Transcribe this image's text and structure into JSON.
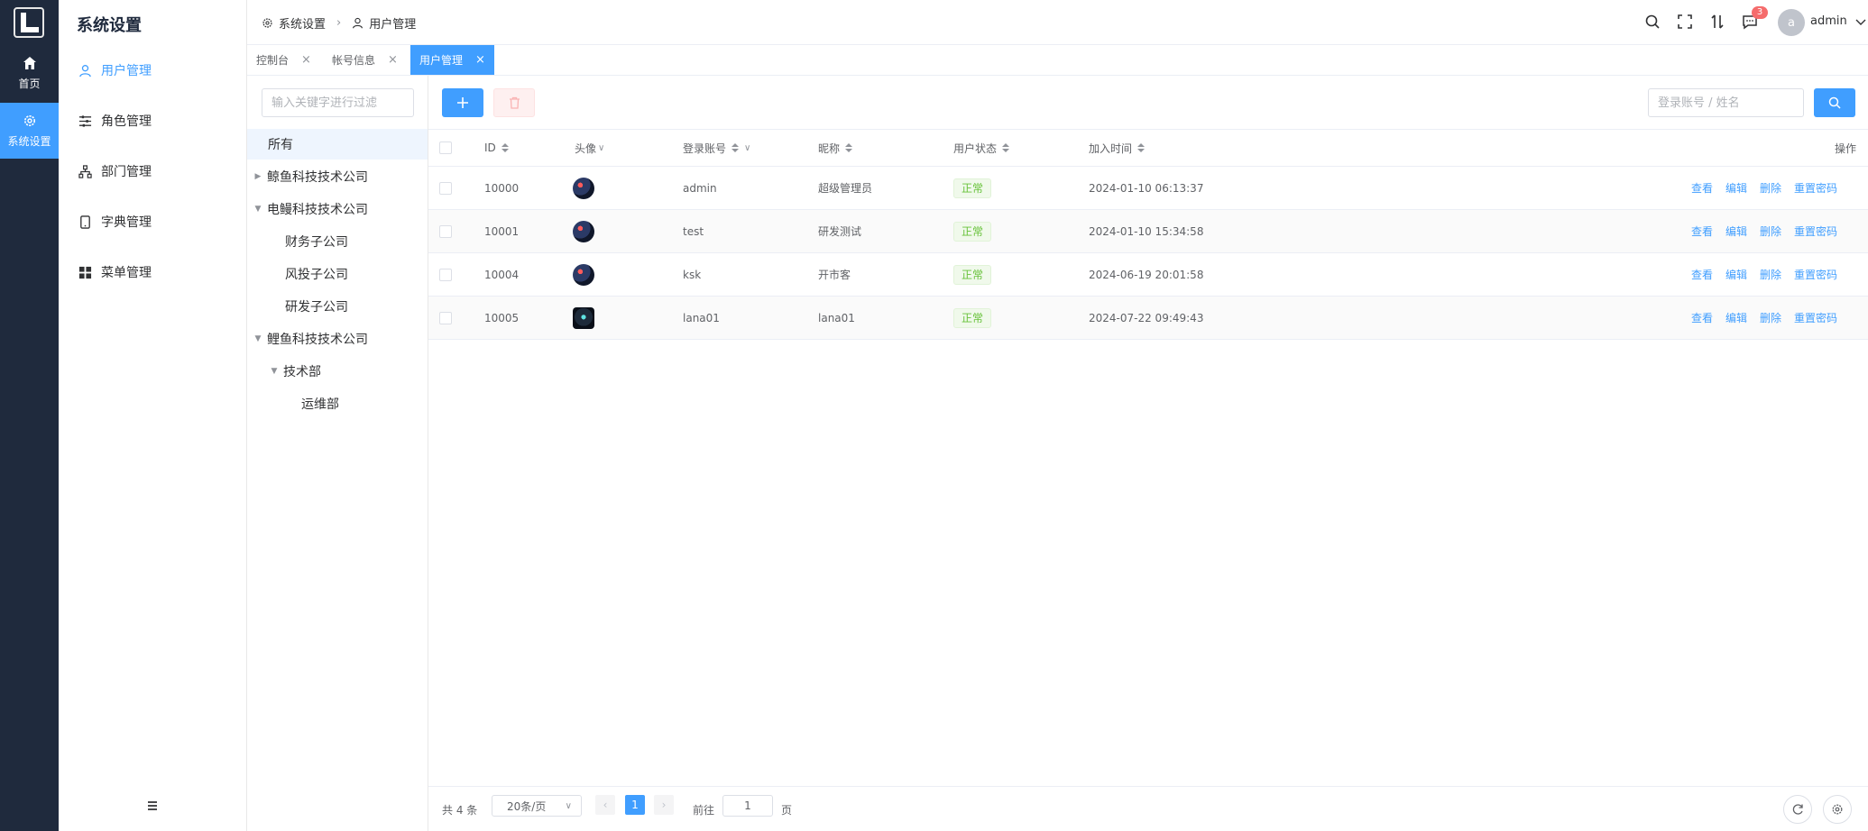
{
  "rail": {
    "home_label": "首页",
    "settings_label": "系统设置"
  },
  "submenu": {
    "title": "系统设置",
    "items": [
      {
        "label": "用户管理",
        "icon": "user-icon"
      },
      {
        "label": "角色管理",
        "icon": "sliders-icon"
      },
      {
        "label": "部门管理",
        "icon": "org-icon"
      },
      {
        "label": "字典管理",
        "icon": "tablet-icon"
      },
      {
        "label": "菜单管理",
        "icon": "grid-icon"
      }
    ]
  },
  "header": {
    "breadcrumb": [
      "系统设置",
      "用户管理"
    ],
    "notifications": "3",
    "avatar_letter": "a",
    "username": "admin"
  },
  "tabs": [
    {
      "label": "控制台"
    },
    {
      "label": "帐号信息"
    },
    {
      "label": "用户管理"
    }
  ],
  "tree": {
    "filter_placeholder": "输入关键字进行过滤",
    "nodes": [
      {
        "label": "所有"
      },
      {
        "label": "鲸鱼科技技术公司"
      },
      {
        "label": "电鳗科技技术公司"
      },
      {
        "label": "财务子公司"
      },
      {
        "label": "风投子公司"
      },
      {
        "label": "研发子公司"
      },
      {
        "label": "鲤鱼科技技术公司"
      },
      {
        "label": "技术部"
      },
      {
        "label": "运维部"
      }
    ]
  },
  "toolbar": {
    "search_placeholder": "登录账号 / 姓名"
  },
  "table": {
    "headers": {
      "id": "ID",
      "avatar": "头像",
      "account": "登录账号",
      "nickname": "昵称",
      "status": "用户状态",
      "joined": "加入时间",
      "actions": "操作"
    },
    "rows": [
      {
        "id": "10000",
        "account": "admin",
        "nickname": "超级管理员",
        "status": "正常",
        "joined": "2024-01-10 06:13:37"
      },
      {
        "id": "10001",
        "account": "test",
        "nickname": "研发测试",
        "status": "正常",
        "joined": "2024-01-10 15:34:58"
      },
      {
        "id": "10004",
        "account": "ksk",
        "nickname": "开市客",
        "status": "正常",
        "joined": "2024-06-19 20:01:58"
      },
      {
        "id": "10005",
        "account": "lana01",
        "nickname": "lana01",
        "status": "正常",
        "joined": "2024-07-22 09:49:43"
      }
    ],
    "ops": {
      "view": "查看",
      "edit": "编辑",
      "delete": "删除",
      "reset": "重置密码"
    }
  },
  "pager": {
    "total": "共 4 条",
    "page_size": "20条/页",
    "current": "1",
    "goto_label": "前往",
    "goto_value": "1",
    "unit": "页"
  },
  "colors": {
    "primary": "#409eff",
    "rail": "#1f2a3d",
    "success": "#67c23a",
    "danger": "#f56c6c"
  }
}
